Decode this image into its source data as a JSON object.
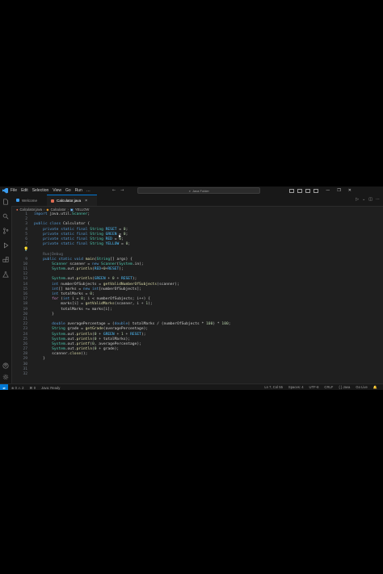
{
  "titlebar": {
    "menu": [
      "File",
      "Edit",
      "Selection",
      "View",
      "Go",
      "Run",
      "…"
    ],
    "search_text": "Java Folder",
    "back_icon": "arrow-left-icon",
    "forward_icon": "arrow-right-icon"
  },
  "tabs": [
    {
      "label": "Welcome",
      "icon": "vscode-logo-icon",
      "color": "#3b9df0"
    },
    {
      "label": "Calculator.java",
      "icon": "java-file-icon",
      "color": "#e06c52",
      "close": "×"
    }
  ],
  "breadcrumb": {
    "file": "Calculator.java",
    "class_name": "Calculator",
    "member": "YELLOW",
    "sep": "›"
  },
  "editor": {
    "line_numbers": [
      "1",
      "2",
      "3",
      "4",
      "5",
      "6",
      "7",
      "8",
      "",
      "9",
      "10",
      "11",
      "12",
      "13",
      "14",
      "15",
      "16",
      "17",
      "18",
      "19",
      "20",
      "21",
      "22",
      "23",
      "24",
      "25",
      "26",
      "27",
      "28",
      "29",
      "30",
      "31",
      "32"
    ],
    "active_line": "8",
    "lines": [
      "import java.util.Scanner;",
      "",
      "public class Calculator {",
      "    private static final String RESET = \"\\u001B[0m\";",
      "    private static final String GREEN = \"\\u001B[32m\";",
      "    private static final String RED = \"\\u001B[31m\";",
      "    private static final String YELLOW = \"\\u001B[33m\";",
      "",
      "    Run|Debug",
      "    public static void main(String[] args) {",
      "        Scanner scanner = new Scanner(System.in);",
      "        System.out.println(RED+\"***************WELCOME*****************\"+RESET);",
      "",
      "        System.out.println(GREEN + \"Welcome to the Enhanced Grade Calculator!\" + RESET);",
      "        int numberOfSubjects = getValidNumberOfSubjects(scanner);",
      "        int[] marks = new int[numberOfSubjects];",
      "        int totalMarks = 0;",
      "        for (int i = 0; i < numberOfSubjects; i++) {",
      "            marks[i] = getValidMarks(scanner, i + 1);",
      "            totalMarks += marks[i];",
      "        }",
      "",
      "        double averagePercentage = (double) totalMarks / (numberOfSubjects * 100) * 100;",
      "        String grade = getGrade(averagePercentage);",
      "        System.out.println(\"\\n\" + GREEN + \"Results:\" + RESET);",
      "        System.out.println(\"Total Marks: \" + totalMarks);",
      "        System.out.printf(\"Average Percentage: %.2f%%%n\", averagePercentage);",
      "        System.out.println(\"Grade: \" + grade);",
      "        scanner.close();",
      "    }",
      "",
      "",
      ""
    ]
  },
  "statusbar": {
    "remote": "⇄",
    "problems": "⊗ 0 ⚠ 2",
    "ports": "⌘ 0",
    "java_status": "Java: Ready",
    "position": "Ln 7, Col 55",
    "spaces": "Spaces: 4",
    "encoding": "UTF-8",
    "eol": "CRLF",
    "language": "{ } Java",
    "golive": "Go Live"
  },
  "colors": {
    "editor_bg": "#1f1f1f",
    "chrome_bg": "#181818",
    "accent": "#0078d4",
    "keyword": "#569cd6",
    "type": "#4ec9b0",
    "string": "#ce9178",
    "constant": "#4fc1ff",
    "method": "#dcdcaa",
    "number": "#b5cea8",
    "control": "#c586c0"
  }
}
